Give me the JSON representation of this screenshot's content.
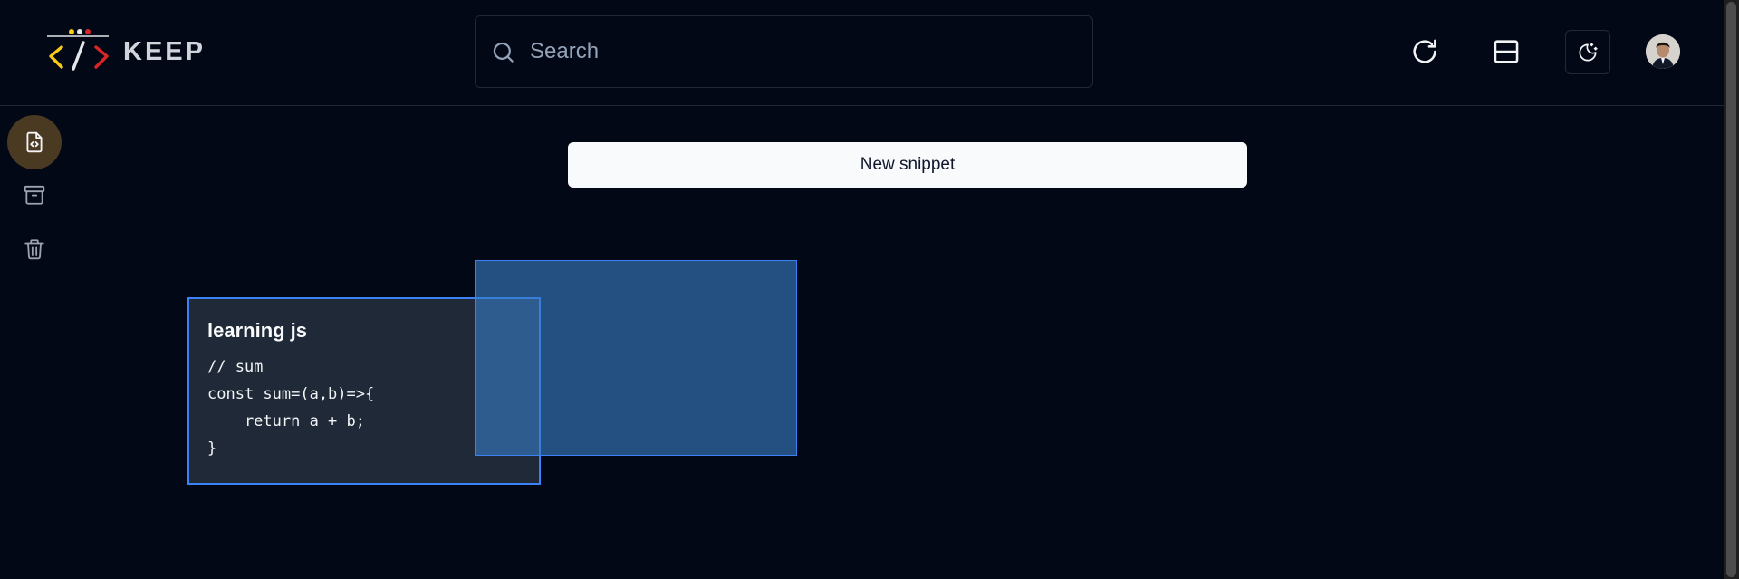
{
  "app": {
    "name": "KEEP",
    "logo_icon": "code-brackets-logo"
  },
  "search": {
    "placeholder": "Search",
    "value": "",
    "icon": "search-icon"
  },
  "header_actions": {
    "refresh_icon": "refresh-icon",
    "layout_icon": "layout-toggle-icon",
    "theme_icon": "moon-icon",
    "avatar": "user-avatar"
  },
  "sidebar": {
    "items": [
      {
        "name": "snippets",
        "icon": "file-code-icon",
        "active": true
      },
      {
        "name": "archive",
        "icon": "archive-icon",
        "active": false
      },
      {
        "name": "trash",
        "icon": "trash-icon",
        "active": false
      }
    ]
  },
  "main": {
    "new_snippet_label": "New snippet",
    "snippets": [
      {
        "title": "learning js",
        "code": "// sum\nconst sum=(a,b)=>{\n    return a + b;\n}"
      }
    ]
  },
  "colors": {
    "background": "#030817",
    "accent": "#3b82f6",
    "card_bg": "#1f2937",
    "active_sidebar": "#4b3a22",
    "selection": "#387dc4",
    "logo_yellow": "#facc15",
    "logo_red": "#dc2626"
  }
}
